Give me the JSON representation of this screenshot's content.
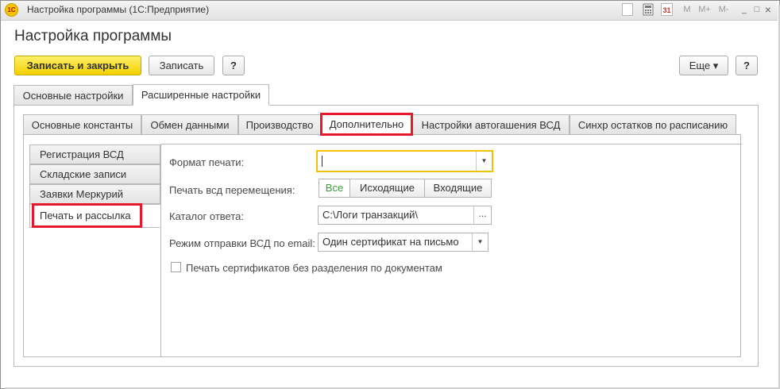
{
  "window": {
    "title": "Настройка программы  (1С:Предприятие)",
    "logo_text": "1С",
    "title_icons": [
      "document-icon",
      "calculator-icon",
      "calendar-icon",
      "memory-m-icon",
      "memory-mplus-icon",
      "memory-mminus-icon",
      "minimize-icon",
      "restore-icon",
      "close-icon"
    ],
    "memory_labels": [
      "M",
      "M+",
      "M-"
    ],
    "calendar_label": "31",
    "minimize_label": "_",
    "restore_label": "□",
    "close_label": "×"
  },
  "form": {
    "title": "Настройка программы",
    "toolbar": {
      "save_close_label": "Записать и закрыть",
      "save_label": "Записать",
      "help_label": "?",
      "more_label": "Еще ▾",
      "help2_label": "?"
    }
  },
  "outer_tabs": [
    {
      "label": "Основные настройки",
      "active": false
    },
    {
      "label": "Расширенные настройки",
      "active": true
    }
  ],
  "inner_tabs": [
    {
      "label": "Основные константы",
      "active": false
    },
    {
      "label": "Обмен данными",
      "active": false
    },
    {
      "label": "Производство",
      "active": false
    },
    {
      "label": "Дополнительно",
      "active": true
    },
    {
      "label": "Настройки автогашения ВСД",
      "active": false
    },
    {
      "label": "Синхр остатков по расписанию",
      "active": false
    }
  ],
  "vertical_tabs": [
    {
      "label": "Регистрация ВСД",
      "active": false
    },
    {
      "label": "Складские записи",
      "active": false
    },
    {
      "label": "Заявки Меркурий",
      "active": false
    },
    {
      "label": "Печать и рассылка",
      "active": true
    }
  ],
  "fields": {
    "print_format": {
      "label": "Формат печати:",
      "value": ""
    },
    "move_print": {
      "label": "Печать всд перемещения:",
      "options": [
        "Все",
        "Исходящие",
        "Входящие"
      ],
      "selected": "Все"
    },
    "reply_catalog": {
      "label": "Каталог ответа:",
      "value": "C:\\Логи транзакций\\",
      "button": "..."
    },
    "email_mode": {
      "label": "Режим отправки ВСД по email:",
      "value": "Один сертификат на письмо"
    },
    "no_split_checkbox": {
      "label": "Печать сертификатов без разделения по документам",
      "checked": false
    }
  },
  "colors": {
    "highlight": "#e8192c",
    "primary_button": "#f3d000",
    "focus_border": "#f2c200",
    "selected_option": "#3a9b3a"
  }
}
